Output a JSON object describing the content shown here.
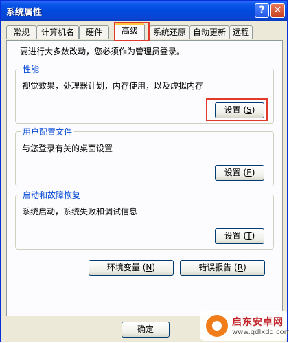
{
  "window": {
    "title": "系统属性",
    "help_label": "?",
    "close_label": "✕"
  },
  "tabs": [
    "常规",
    "计算机名",
    "硬件",
    "高级",
    "系统还原",
    "自动更新",
    "远程"
  ],
  "active_tab": "高级",
  "intro": "要进行大多数改动，您必须作为管理员登录。",
  "performance": {
    "title": "性能",
    "desc": "视觉效果，处理器计划，内存使用，以及虚拟内存",
    "button": "设置",
    "hotkey": "S"
  },
  "profiles": {
    "title": "用户配置文件",
    "desc": "与您登录有关的桌面设置",
    "button": "设置",
    "hotkey": "E"
  },
  "startup": {
    "title": "启动和故障恢复",
    "desc": "系统启动，系统失败和调试信息",
    "button": "设置",
    "hotkey": "T"
  },
  "env_button": {
    "label": "环境变量",
    "hotkey": "N"
  },
  "error_button": {
    "label": "错误报告",
    "hotkey": "R"
  },
  "ok_button": "确定",
  "watermark": {
    "title": "启东安卓网",
    "url": "www.qdlxdq.com"
  },
  "colors": {
    "title_bar": "#0a56e8",
    "group_title": "#0046d5",
    "highlight": "#e03a2a",
    "watermark": "#c1272d"
  }
}
